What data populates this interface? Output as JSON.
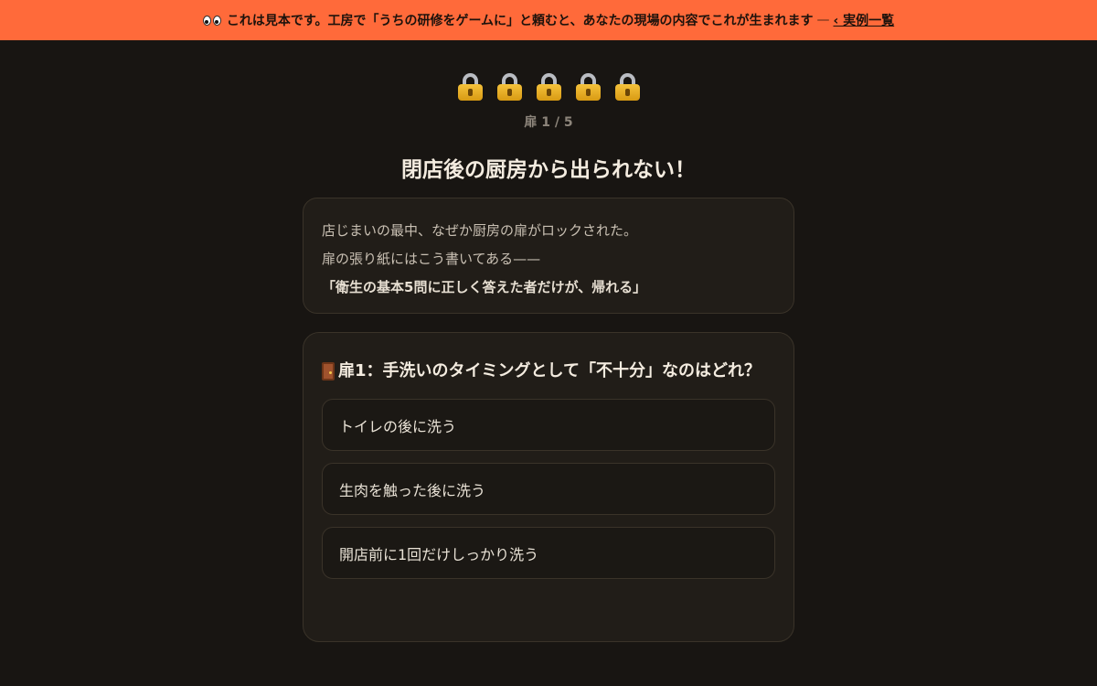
{
  "banner": {
    "message": "これは見本です。工房で「うちの研修をゲームに」と頼むと、あなたの現場の内容でこれが生まれます",
    "separator": "—",
    "link_label": "‹ 実例一覧",
    "icon": "eyes-icon"
  },
  "progress": {
    "locks": [
      "lock-icon",
      "lock-icon",
      "lock-icon",
      "lock-icon",
      "lock-icon"
    ],
    "door_count": "扉 1 / 5"
  },
  "title": "閉店後の厨房から出られない！",
  "story": {
    "lines": [
      "店じまいの最中、なぜか厨房の扉がロックされた。",
      "扉の張り紙にはこう書いてある——"
    ],
    "emphasis": "「衛生の基本5問に正しく答えた者だけが、帰れる」"
  },
  "quiz": {
    "icon": "door-icon",
    "question": "扉1：手洗いのタイミングとして「不十分」なのはどれ？",
    "options": [
      "トイレの後に洗う",
      "生肉を触った後に洗う",
      "開店前に1回だけしっかり洗う"
    ]
  },
  "colors": {
    "banner_bg": "#ff6a3a",
    "page_bg": "#181512",
    "card_bg": "#211d18"
  }
}
